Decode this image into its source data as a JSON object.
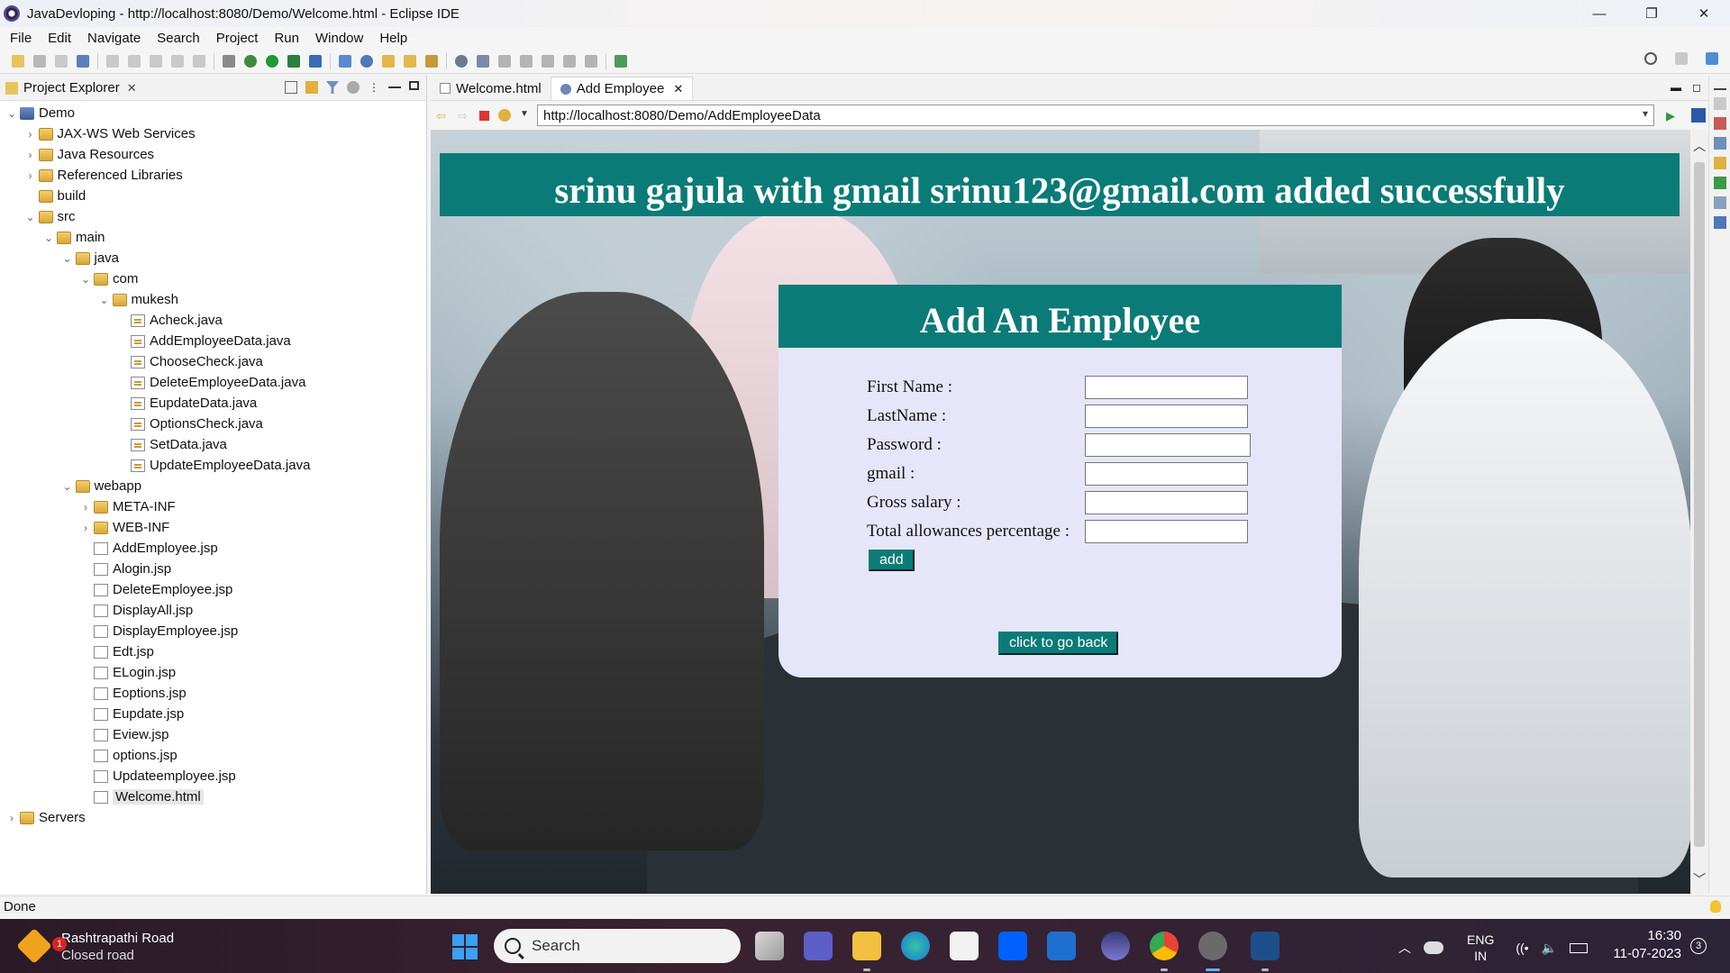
{
  "window": {
    "title": "JavaDevloping - http://localhost:8080/Demo/Welcome.html - Eclipse IDE",
    "controls": [
      "—",
      "❐",
      "✕"
    ]
  },
  "menu": [
    "File",
    "Edit",
    "Navigate",
    "Search",
    "Project",
    "Run",
    "Window",
    "Help"
  ],
  "project_explorer": {
    "tab_label": "Project Explorer",
    "tree": [
      {
        "label": "Demo",
        "depth": 0,
        "expanded": true,
        "icon": "project-icon"
      },
      {
        "label": "JAX-WS Web Services",
        "depth": 1,
        "expanded": false,
        "icon": "webservice-icon"
      },
      {
        "label": "Java Resources",
        "depth": 1,
        "expanded": false,
        "icon": "java-resources-icon"
      },
      {
        "label": "Referenced Libraries",
        "depth": 1,
        "expanded": false,
        "icon": "library-icon"
      },
      {
        "label": "build",
        "depth": 1,
        "expanded": null,
        "icon": "folder-icon"
      },
      {
        "label": "src",
        "depth": 1,
        "expanded": true,
        "icon": "folder-icon"
      },
      {
        "label": "main",
        "depth": 2,
        "expanded": true,
        "icon": "folder-icon"
      },
      {
        "label": "java",
        "depth": 3,
        "expanded": true,
        "icon": "folder-icon"
      },
      {
        "label": "com",
        "depth": 4,
        "expanded": true,
        "icon": "folder-icon"
      },
      {
        "label": "mukesh",
        "depth": 5,
        "expanded": true,
        "icon": "folder-icon"
      },
      {
        "label": "Acheck.java",
        "depth": 6,
        "expanded": null,
        "icon": "java-file-icon"
      },
      {
        "label": "AddEmployeeData.java",
        "depth": 6,
        "expanded": null,
        "icon": "java-file-icon"
      },
      {
        "label": "ChooseCheck.java",
        "depth": 6,
        "expanded": null,
        "icon": "java-file-icon"
      },
      {
        "label": "DeleteEmployeeData.java",
        "depth": 6,
        "expanded": null,
        "icon": "java-file-icon"
      },
      {
        "label": "EupdateData.java",
        "depth": 6,
        "expanded": null,
        "icon": "java-file-icon"
      },
      {
        "label": "OptionsCheck.java",
        "depth": 6,
        "expanded": null,
        "icon": "java-file-icon"
      },
      {
        "label": "SetData.java",
        "depth": 6,
        "expanded": null,
        "icon": "java-file-icon"
      },
      {
        "label": "UpdateEmployeeData.java",
        "depth": 6,
        "expanded": null,
        "icon": "java-file-icon"
      },
      {
        "label": "webapp",
        "depth": 3,
        "expanded": true,
        "icon": "folder-icon"
      },
      {
        "label": "META-INF",
        "depth": 4,
        "expanded": false,
        "icon": "folder-icon"
      },
      {
        "label": "WEB-INF",
        "depth": 4,
        "expanded": false,
        "icon": "folder-icon"
      },
      {
        "label": "AddEmployee.jsp",
        "depth": 4,
        "expanded": null,
        "icon": "jsp-file-icon"
      },
      {
        "label": "Alogin.jsp",
        "depth": 4,
        "expanded": null,
        "icon": "jsp-file-icon"
      },
      {
        "label": "DeleteEmployee.jsp",
        "depth": 4,
        "expanded": null,
        "icon": "jsp-file-icon"
      },
      {
        "label": "DisplayAll.jsp",
        "depth": 4,
        "expanded": null,
        "icon": "jsp-file-icon"
      },
      {
        "label": "DisplayEmployee.jsp",
        "depth": 4,
        "expanded": null,
        "icon": "jsp-file-icon"
      },
      {
        "label": "Edt.jsp",
        "depth": 4,
        "expanded": null,
        "icon": "jsp-file-icon"
      },
      {
        "label": "ELogin.jsp",
        "depth": 4,
        "expanded": null,
        "icon": "jsp-file-icon"
      },
      {
        "label": "Eoptions.jsp",
        "depth": 4,
        "expanded": null,
        "icon": "jsp-file-icon"
      },
      {
        "label": "Eupdate.jsp",
        "depth": 4,
        "expanded": null,
        "icon": "jsp-file-icon"
      },
      {
        "label": "Eview.jsp",
        "depth": 4,
        "expanded": null,
        "icon": "jsp-file-icon"
      },
      {
        "label": "options.jsp",
        "depth": 4,
        "expanded": null,
        "icon": "jsp-file-icon"
      },
      {
        "label": "Updateemployee.jsp",
        "depth": 4,
        "expanded": null,
        "icon": "jsp-file-icon"
      },
      {
        "label": "Welcome.html",
        "depth": 4,
        "expanded": null,
        "icon": "html-file-icon",
        "selected": true
      },
      {
        "label": "Servers",
        "depth": 0,
        "expanded": false,
        "icon": "folder-icon"
      }
    ]
  },
  "editor": {
    "tabs": [
      {
        "label": "Welcome.html",
        "active": false
      },
      {
        "label": "Add Employee",
        "active": true
      }
    ],
    "url": "http://localhost:8080/Demo/AddEmployeeData"
  },
  "page": {
    "banner": "srinu gajula with gmail srinu123@gmail.com added successfully",
    "form_title": "Add An Employee",
    "fields": [
      {
        "label": "First Name :",
        "value": ""
      },
      {
        "label": "LastName :",
        "value": ""
      },
      {
        "label": "Password :",
        "value": ""
      },
      {
        "label": "gmail :",
        "value": ""
      },
      {
        "label": "Gross salary :",
        "value": ""
      },
      {
        "label": "Total allowances percentage :",
        "value": ""
      }
    ],
    "add_button": "add",
    "back_button": "click to go back"
  },
  "status": {
    "text": "Done"
  },
  "taskbar": {
    "weather_badge": "1",
    "weather_title": "Rashtrapathi Road",
    "weather_sub": "Closed road",
    "search_label": "Search",
    "lang_top": "ENG",
    "lang_bottom": "IN",
    "time": "16:30",
    "date": "11-07-2023",
    "notif_count": "3"
  },
  "colors": {
    "teal": "#0b7b78",
    "form_bg": "#e6e6fa",
    "taskbar": "#2a1a28"
  }
}
